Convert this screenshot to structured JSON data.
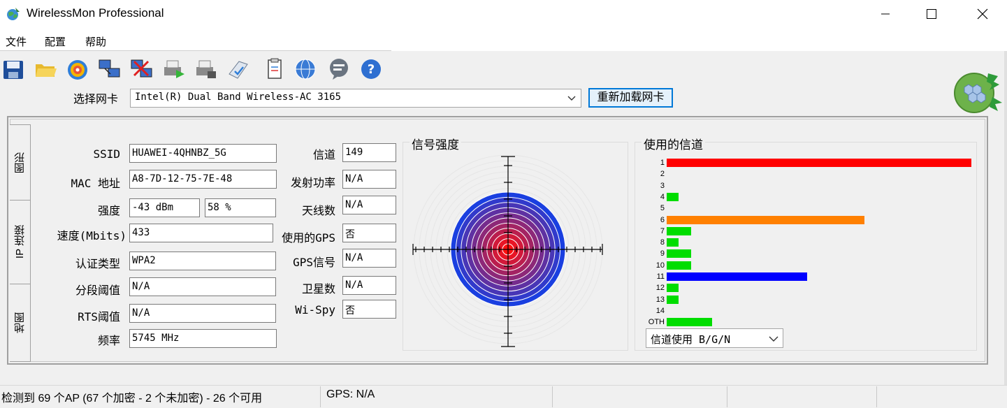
{
  "window": {
    "title": "WirelessMon Professional",
    "minimize_glyph": "—",
    "maximize_glyph": "☐",
    "close_glyph": "✕"
  },
  "menu": [
    {
      "label": "文件"
    },
    {
      "label": "配置"
    },
    {
      "label": "帮助"
    }
  ],
  "toolbar": {
    "icons": [
      "save-icon",
      "open-folder-icon",
      "target-icon",
      "network-computers-icon",
      "network-disconnect-icon",
      "print-green-icon",
      "print-gray-icon",
      "clipboard-check-icon",
      "document-icon",
      "globe-icon",
      "chat-icon",
      "help-icon"
    ]
  },
  "adapter": {
    "label": "选择网卡",
    "selected": "Intel(R) Dual Band Wireless-AC 3165",
    "reload_label": "重新加载网卡"
  },
  "tabs": [
    {
      "label": "图形"
    },
    {
      "label": "IP 连接"
    },
    {
      "label": "地图"
    }
  ],
  "info": {
    "ssid_label": "SSID",
    "ssid": "HUAWEI-4QHNBZ_5G",
    "mac_label": "MAC 地址",
    "mac": "A8-7D-12-75-7E-48",
    "strength_label": "强度",
    "strength_dbm": "-43 dBm",
    "strength_pct": "58 %",
    "speed_label": "速度(Mbits)",
    "speed": "433",
    "auth_label": "认证类型",
    "auth": "WPA2",
    "frag_label": "分段阈值",
    "frag": "N/A",
    "rts_label": "RTS阈值",
    "rts": "N/A",
    "freq_label": "频率",
    "freq": "5745 MHz",
    "channel_label": "信道",
    "channel": "149",
    "txpower_label": "发射功率",
    "txpower": "N/A",
    "antennas_label": "天线数",
    "antennas": "N/A",
    "gps_used_label": "使用的GPS",
    "gps_used": "否",
    "gps_signal_label": "GPS信号",
    "gps_signal": "N/A",
    "satellites_label": "卫星数",
    "satellites": "N/A",
    "wispy_label": "Wi-Spy",
    "wispy": "否"
  },
  "signal": {
    "title": "信号强度",
    "colors": {
      "outer": "#1a3fe0",
      "inner": "#ff1010"
    }
  },
  "channels": {
    "title": "使用的信道",
    "dropdown": "信道使用 B/G/N",
    "max": 100,
    "bars": [
      {
        "label": "1",
        "value": 100,
        "color": "#ff0000"
      },
      {
        "label": "2",
        "value": 0,
        "color": "#00dd00"
      },
      {
        "label": "3",
        "value": 0,
        "color": "#00dd00"
      },
      {
        "label": "4",
        "value": 4,
        "color": "#00dd00"
      },
      {
        "label": "5",
        "value": 0,
        "color": "#00dd00"
      },
      {
        "label": "6",
        "value": 65,
        "color": "#ff8000"
      },
      {
        "label": "7",
        "value": 8,
        "color": "#00dd00"
      },
      {
        "label": "8",
        "value": 4,
        "color": "#00dd00"
      },
      {
        "label": "9",
        "value": 8,
        "color": "#00dd00"
      },
      {
        "label": "10",
        "value": 8,
        "color": "#00dd00"
      },
      {
        "label": "11",
        "value": 46,
        "color": "#0000ff"
      },
      {
        "label": "12",
        "value": 4,
        "color": "#00dd00"
      },
      {
        "label": "13",
        "value": 4,
        "color": "#00dd00"
      },
      {
        "label": "14",
        "value": 0,
        "color": "#00dd00"
      },
      {
        "label": "OTH",
        "value": 15,
        "color": "#00dd00"
      }
    ]
  },
  "status": {
    "ap_summary": "检测到 69 个AP (67 个加密 - 2 个未加密) - 26 个可用",
    "gps": "GPS: N/A"
  }
}
